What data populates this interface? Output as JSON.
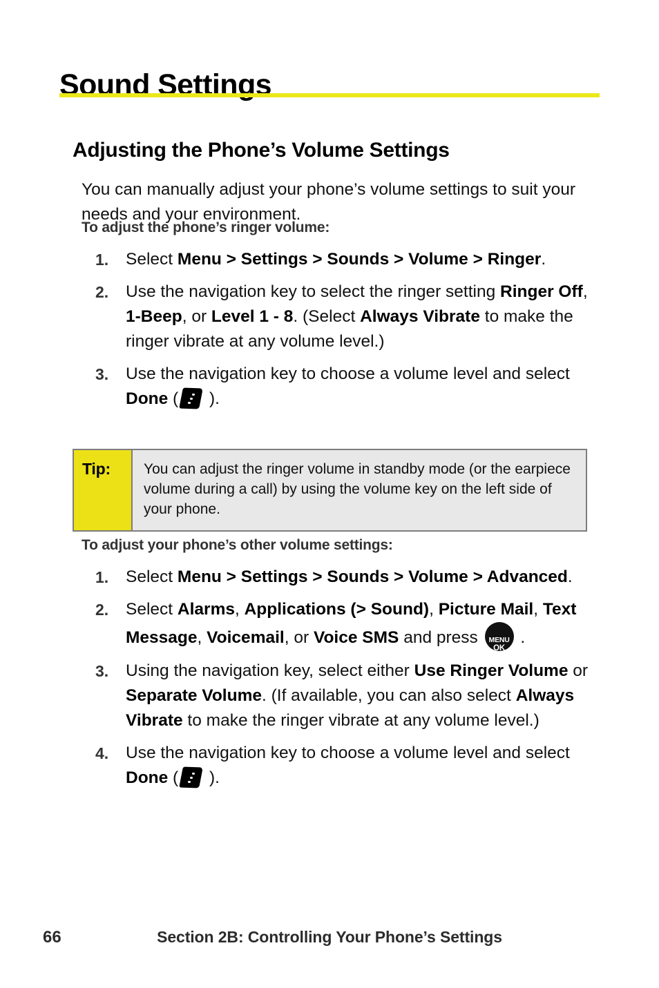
{
  "page": {
    "title": "Sound Settings",
    "rule_color": "#ece818",
    "section_heading": "Adjusting the Phone’s Volume Settings",
    "intro": "You can manually adjust your phone’s volume settings to suit your needs and your environment."
  },
  "procedure_1": {
    "title": "To adjust the phone’s ringer volume:",
    "steps": [
      {
        "number": "1.",
        "parts": [
          {
            "text": "Select ",
            "bold": false
          },
          {
            "text": "Menu > Settings > Sounds > Volume > Ringer",
            "bold": true
          },
          {
            "text": ".",
            "bold": false
          }
        ]
      },
      {
        "number": "2.",
        "parts": [
          {
            "text": "Use the navigation key to select the ringer setting ",
            "bold": false
          },
          {
            "text": "Ringer Off",
            "bold": true
          },
          {
            "text": ", ",
            "bold": false
          },
          {
            "text": "1-Beep",
            "bold": true
          },
          {
            "text": ", or ",
            "bold": false
          },
          {
            "text": "Level 1 - 8",
            "bold": true
          },
          {
            "text": ". (Select ",
            "bold": false
          },
          {
            "text": "Always Vibrate",
            "bold": true
          },
          {
            "text": " to make the ringer vibrate at any volume level.)",
            "bold": false
          }
        ]
      },
      {
        "number": "3.",
        "parts": [
          {
            "text": "Use the navigation key to choose a volume level and select ",
            "bold": false
          },
          {
            "text": "Done",
            "bold": true
          },
          {
            "text": " (",
            "bold": false
          },
          {
            "icon": "softkey-done-icon"
          },
          {
            "text": " ).",
            "bold": false
          }
        ]
      }
    ]
  },
  "tip": {
    "label": "Tip:",
    "text": "You can adjust the ringer volume in standby mode (or the earpiece volume during a call) by using the volume key on the left side of your phone.",
    "label_background": "#ece017",
    "body_background": "#e8e8e8",
    "border_color": "#7d7d7d"
  },
  "procedure_2": {
    "title": "To adjust your phone’s other volume settings:",
    "steps": [
      {
        "number": "1.",
        "parts": [
          {
            "text": "Select ",
            "bold": false
          },
          {
            "text": "Menu > Settings > Sounds > Volume > Advanced",
            "bold": true
          },
          {
            "text": ".",
            "bold": false
          }
        ]
      },
      {
        "number": "2.",
        "parts": [
          {
            "text": "Select ",
            "bold": false
          },
          {
            "text": "Alarms",
            "bold": true
          },
          {
            "text": ", ",
            "bold": false
          },
          {
            "text": "Applications (> Sound)",
            "bold": true
          },
          {
            "text": ", ",
            "bold": false
          },
          {
            "text": "Picture Mail",
            "bold": true
          },
          {
            "text": ", ",
            "bold": false
          },
          {
            "text": "Text Message",
            "bold": true
          },
          {
            "text": ", ",
            "bold": false
          },
          {
            "text": "Voicemail",
            "bold": true
          },
          {
            "text": ", or ",
            "bold": false
          },
          {
            "text": "Voice SMS",
            "bold": true
          },
          {
            "text": " and press ",
            "bold": false
          },
          {
            "icon": "menu-ok-key-icon"
          },
          {
            "text": " .",
            "bold": false
          }
        ]
      },
      {
        "number": "3.",
        "parts": [
          {
            "text": "Using the navigation key, select either ",
            "bold": false
          },
          {
            "text": "Use Ringer Volume",
            "bold": true
          },
          {
            "text": " or ",
            "bold": false
          },
          {
            "text": "Separate Volume",
            "bold": true
          },
          {
            "text": ". (If available, you can also select ",
            "bold": false
          },
          {
            "text": "Always Vibrate",
            "bold": true
          },
          {
            "text": " to make the ringer vibrate at any volume level.)",
            "bold": false
          }
        ]
      },
      {
        "number": "4.",
        "parts": [
          {
            "text": "Use the navigation key to choose a volume level and select ",
            "bold": false
          },
          {
            "text": "Done",
            "bold": true
          },
          {
            "text": " (",
            "bold": false
          },
          {
            "icon": "softkey-done-icon"
          },
          {
            "text": " ).",
            "bold": false
          }
        ]
      }
    ]
  },
  "icons": {
    "menu_ok_key": {
      "line1": "MENU",
      "line2": "OK"
    }
  },
  "footer": {
    "page_number": "66",
    "section_label": "Section 2B: Controlling Your Phone’s Settings"
  }
}
